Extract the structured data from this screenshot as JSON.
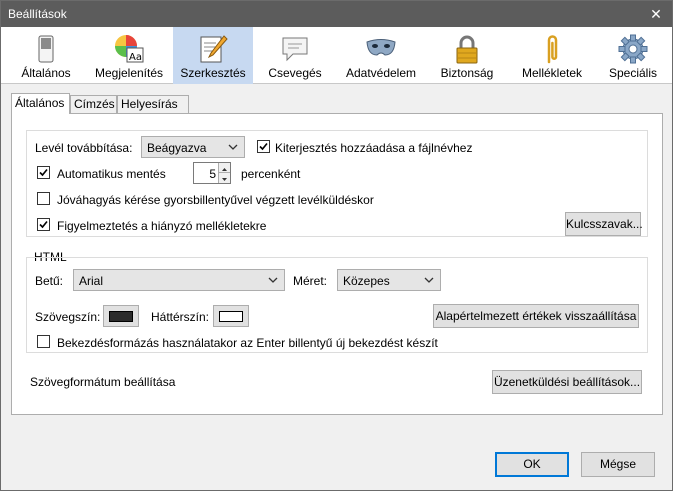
{
  "window": {
    "title": "Beállítások"
  },
  "toolbar": [
    {
      "label": "Általános"
    },
    {
      "label": "Megjelenítés"
    },
    {
      "label": "Szerkesztés"
    },
    {
      "label": "Csevegés"
    },
    {
      "label": "Adatvédelem"
    },
    {
      "label": "Biztonság"
    },
    {
      "label": "Mellékletek"
    },
    {
      "label": "Speciális"
    }
  ],
  "subtabs": [
    {
      "label": "Általános"
    },
    {
      "label": "Címzés"
    },
    {
      "label": "Helyesírás"
    }
  ],
  "general": {
    "forward_label": "Levél továbbítása:",
    "forward_value": "Beágyazva",
    "extension_label": "Kiterjesztés hozzáadása a fájlnévhez",
    "autosave_label": "Automatikus mentés",
    "autosave_value": "5",
    "autosave_unit": "percenként",
    "confirm_label": "Jóváhagyás kérése gyorsbillentyűvel végzett levélküldéskor",
    "warn_label": "Figyelmeztetés a hiányzó mellékletekre",
    "keywords_button": "Kulcsszavak..."
  },
  "html": {
    "legend": "HTML",
    "font_label": "Betű:",
    "font_value": "Arial",
    "size_label": "Méret:",
    "size_value": "Közepes",
    "text_color_label": "Szövegszín:",
    "text_color": "#2b2b2b",
    "bg_color_label": "Háttérszín:",
    "bg_color": "#ffffff",
    "reset_button": "Alapértelmezett értékek visszaállítása",
    "paragraph_label": "Bekezdésformázás használatakor az Enter billentyű új bekezdést készít"
  },
  "text_format": {
    "label": "Szövegformátum beállítása",
    "button": "Üzenetküldési beállítások..."
  },
  "footer": {
    "ok": "OK",
    "cancel": "Mégse"
  }
}
